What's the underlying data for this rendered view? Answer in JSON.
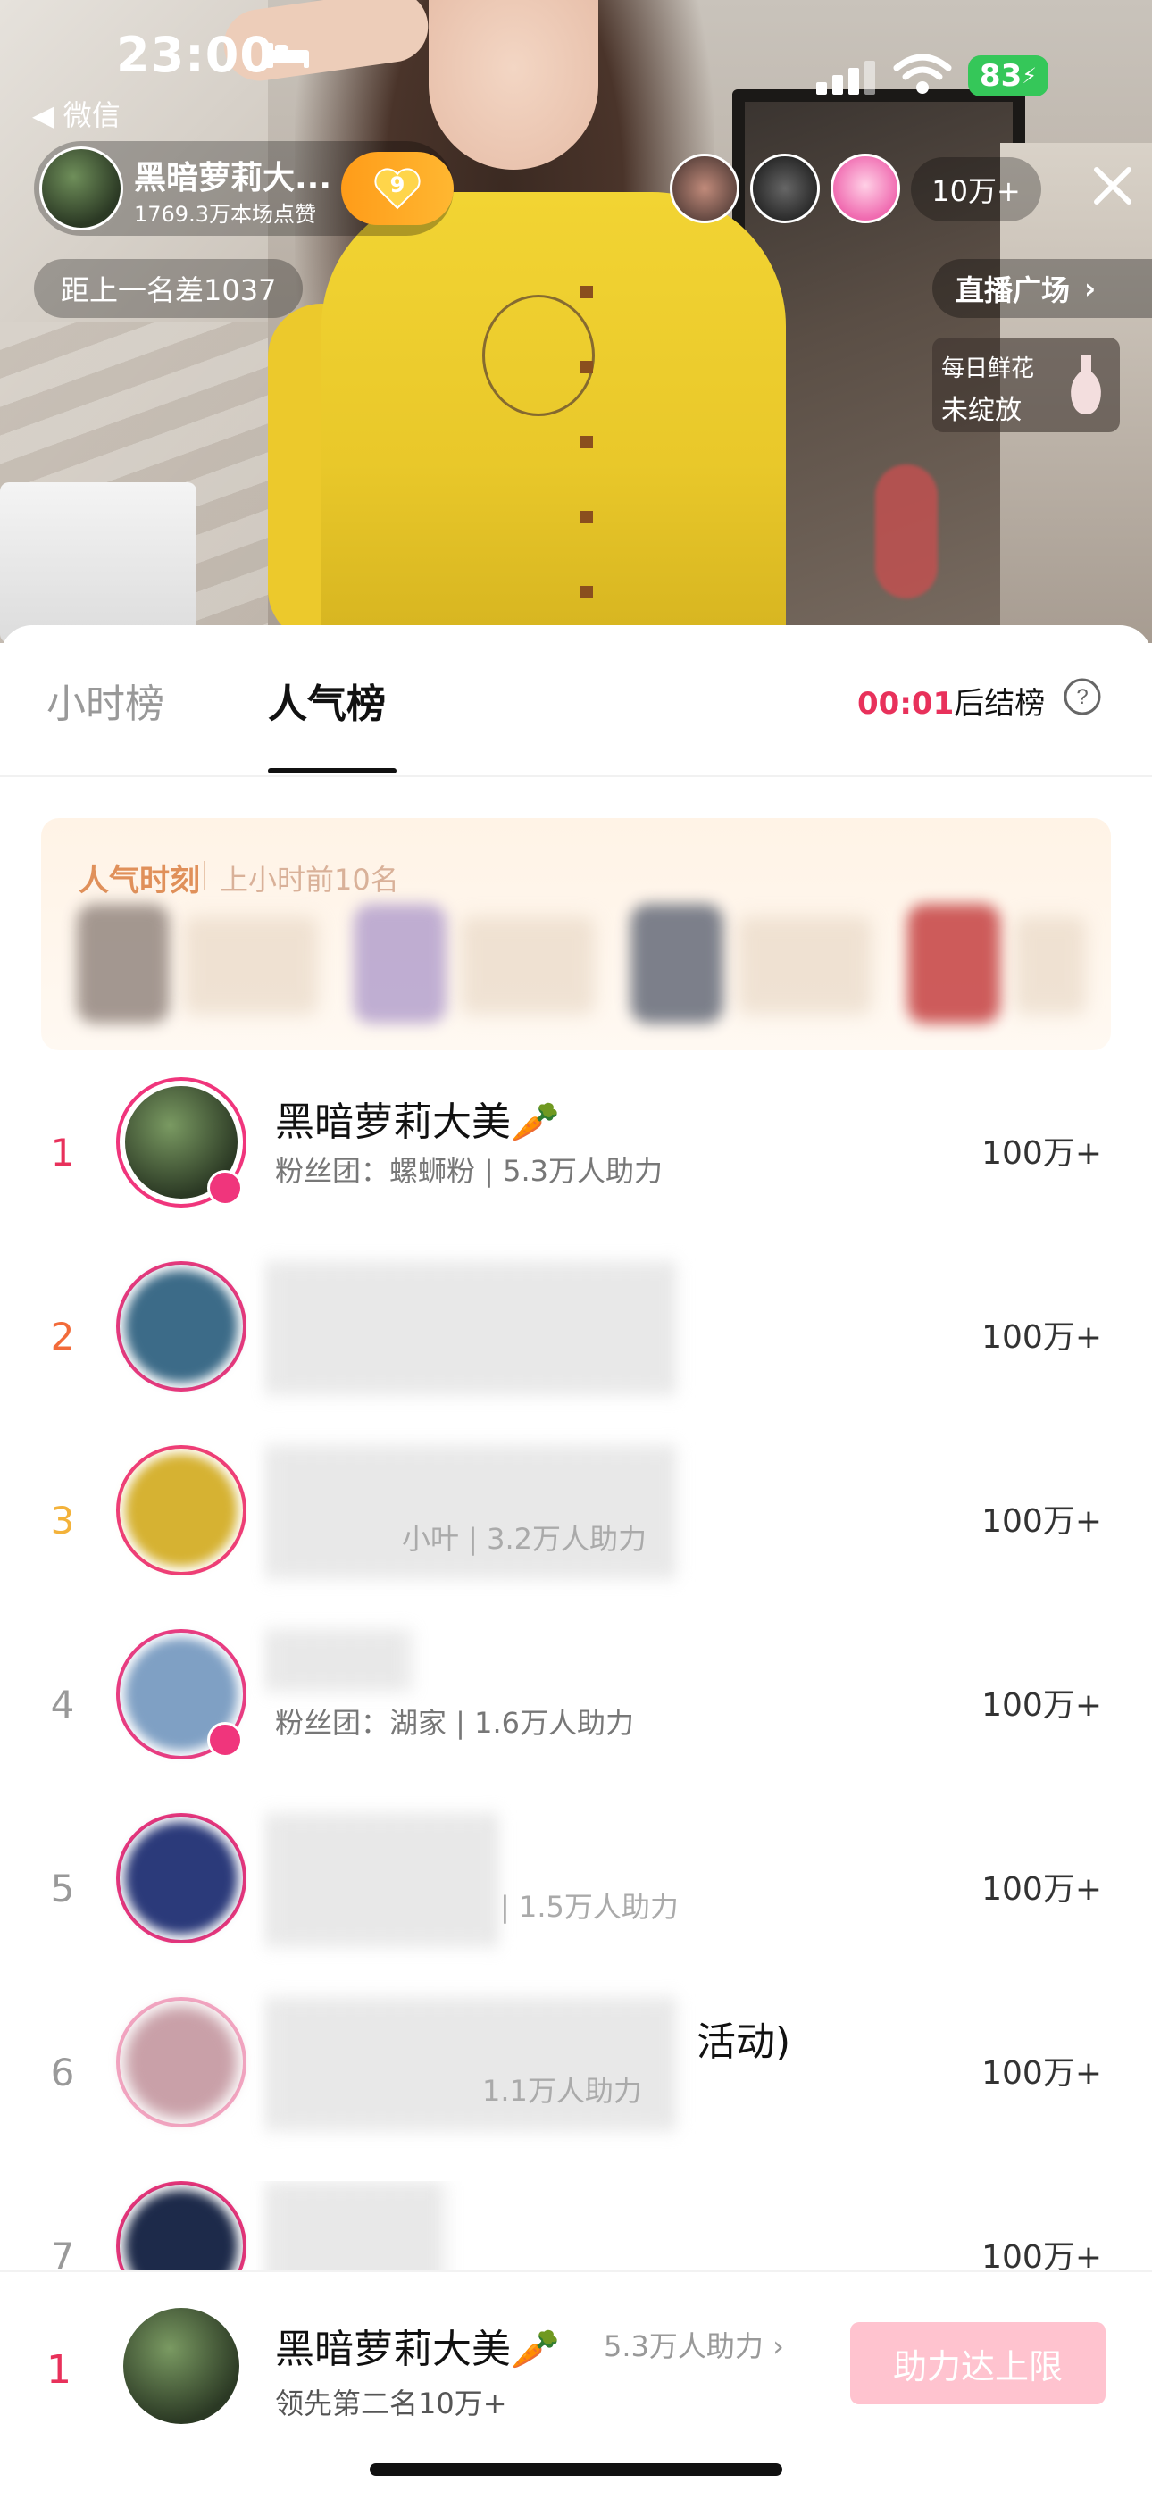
{
  "status_bar": {
    "time": "23:00",
    "battery": "83"
  },
  "back_app": "◀ 微信",
  "host": {
    "name": "黑暗萝莉大...",
    "likes": "1769.3万本场点赞",
    "fan_level": "9"
  },
  "viewer_count": "10万+",
  "rank_gap": "距上一名差1037",
  "plaza": "直播广场",
  "flower": {
    "line1": "每日鲜花",
    "line2": "未绽放"
  },
  "tabs": {
    "hour": "小时榜",
    "popular": "人气榜"
  },
  "countdown": {
    "time": "00:01",
    "suffix": "后结榜"
  },
  "moments": {
    "title": "人气时刻",
    "subtitle": "上小时前10名"
  },
  "ranking": [
    {
      "rank": "1",
      "name": "黑暗萝莉大美🥕",
      "sub": "粉丝团：螺蛳粉 | 5.3万人助力",
      "value": "100万+"
    },
    {
      "rank": "2",
      "name": "",
      "sub": "",
      "value": "100万+"
    },
    {
      "rank": "3",
      "name": "",
      "sub": "小叶 | 3.2万人助力",
      "value": "100万+"
    },
    {
      "rank": "4",
      "name": "",
      "sub": "粉丝团：湖家 | 1.6万人助力",
      "value": "100万+"
    },
    {
      "rank": "5",
      "name": "",
      "sub": "| 1.5万人助力",
      "value": "100万+"
    },
    {
      "rank": "6",
      "name": "活动)",
      "sub": "1.1万人助力",
      "value": "100万+"
    },
    {
      "rank": "7",
      "name": "",
      "sub": "",
      "value": "100万+"
    }
  ],
  "bottom": {
    "rank": "1",
    "name": "黑暗萝莉大美🥕",
    "support": "5.3万人助力 ›",
    "lead": "领先第二名10万+",
    "button": "助力达上限"
  }
}
